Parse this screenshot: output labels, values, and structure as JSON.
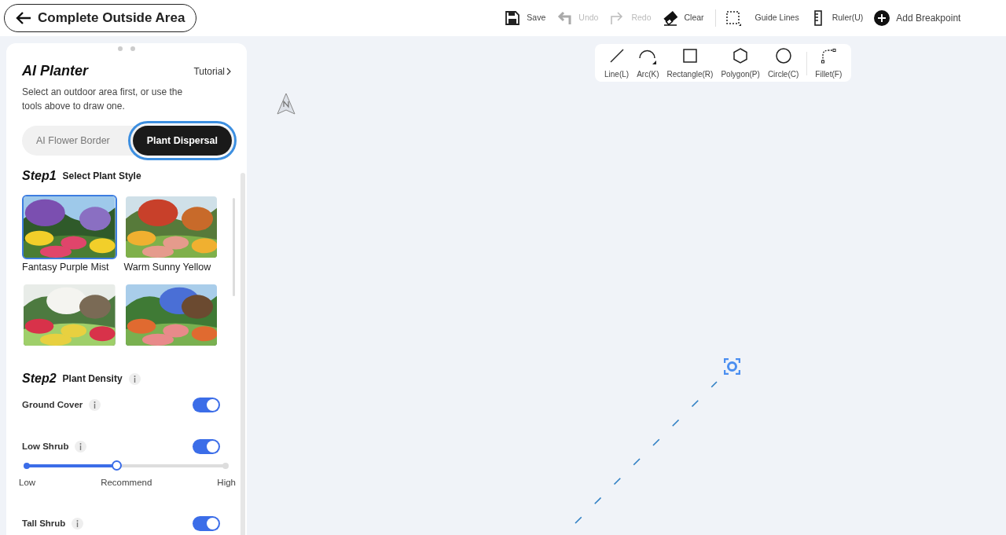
{
  "header": {
    "back_label": "Complete Outside Area"
  },
  "toolbar": [
    {
      "kind": "save",
      "label": "Save",
      "disabled": false
    },
    {
      "kind": "undo",
      "label": "Undo",
      "disabled": true
    },
    {
      "kind": "redo",
      "label": "Redo",
      "disabled": true
    },
    {
      "kind": "clear",
      "label": "Clear",
      "disabled": false
    },
    {
      "kind": "guides",
      "label": "Guide Lines",
      "disabled": false
    },
    {
      "kind": "ruler",
      "label": "Ruler(U)",
      "disabled": false
    },
    {
      "kind": "add",
      "label": "Add Breakpoint",
      "disabled": false
    }
  ],
  "draw_tools": [
    {
      "kind": "line",
      "label": "Line(L)"
    },
    {
      "kind": "arc",
      "label": "Arc(K)"
    },
    {
      "kind": "rect",
      "label": "Rectangle(R)"
    },
    {
      "kind": "polygon",
      "label": "Polygon(P)"
    },
    {
      "kind": "circle",
      "label": "Circle(C)"
    },
    {
      "kind": "fillet",
      "label": "Fillet(F)"
    }
  ],
  "panel": {
    "title": "AI Planter",
    "tutorial": "Tutorial",
    "hint": "Select an outdoor area first, or use the tools above to draw one.",
    "modes": [
      {
        "label": "AI Flower Border",
        "selected": false
      },
      {
        "label": "Plant Dispersal",
        "selected": true
      }
    ],
    "step1": {
      "step": "Step1",
      "title": "Select Plant Style",
      "styles": [
        {
          "label": "Fantasy Purple Mist",
          "selected": true
        },
        {
          "label": "Warm Sunny Yellow",
          "selected": false
        },
        {
          "selected": false
        },
        {
          "selected": false
        }
      ]
    },
    "step2": {
      "step": "Step2",
      "title": "Plant Density",
      "rows": [
        {
          "label": "Ground Cover",
          "on": true
        },
        {
          "label": "Low Shrub",
          "on": true,
          "slider": {
            "level": 0.45,
            "labels": [
              "Low",
              "Recommend",
              "High"
            ]
          }
        },
        {
          "label": "Tall Shrub",
          "on": true
        }
      ]
    }
  }
}
